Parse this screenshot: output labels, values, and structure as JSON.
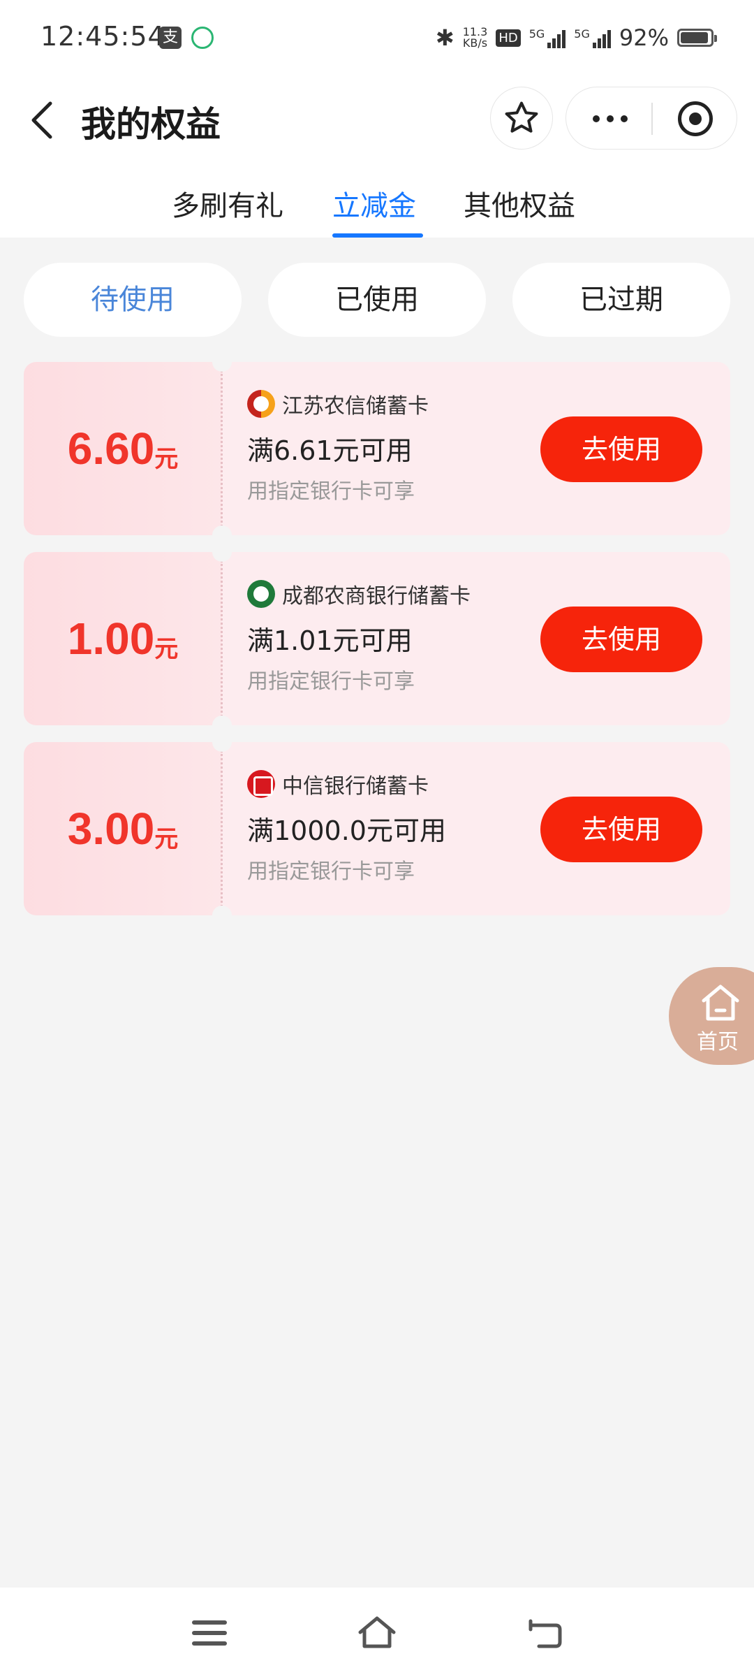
{
  "status": {
    "time": "12:45:54",
    "alipay_glyph": "支",
    "net_speed_value": "11.3",
    "net_speed_unit": "KB/s",
    "hd_label": "HD",
    "sig1_label": "5G",
    "sig2_label": "5G",
    "battery_percent": "92%",
    "battery_level": 0.92
  },
  "header": {
    "title": "我的权益",
    "icons": [
      "back-arrow-icon",
      "star-icon",
      "more-icon",
      "target-icon"
    ]
  },
  "tabs": [
    {
      "label": "多刷有礼",
      "active": false
    },
    {
      "label": "立减金",
      "active": true
    },
    {
      "label": "其他权益",
      "active": false
    }
  ],
  "filters": [
    {
      "label": "待使用",
      "active": true
    },
    {
      "label": "已使用",
      "active": false
    },
    {
      "label": "已过期",
      "active": false
    }
  ],
  "coupons": [
    {
      "amount": "6.60",
      "unit": "元",
      "bank": "江苏农信储蓄卡",
      "condition": "满6.61元可用",
      "hint": "用指定银行卡可享",
      "button": "去使用"
    },
    {
      "amount": "1.00",
      "unit": "元",
      "bank": "成都农商银行储蓄卡",
      "condition": "满1.01元可用",
      "hint": "用指定银行卡可享",
      "button": "去使用"
    },
    {
      "amount": "3.00",
      "unit": "元",
      "bank": "中信银行储蓄卡",
      "condition": "满1000.0元可用",
      "hint": "用指定银行卡可享",
      "button": "去使用"
    }
  ],
  "float_home": {
    "label": "首页"
  },
  "colors": {
    "accent_blue": "#1677ff",
    "amount_red": "#f0352b",
    "button_red": "#f6240b",
    "card_bg": "#fdecef",
    "float_home_bg": "#d9ad98"
  }
}
